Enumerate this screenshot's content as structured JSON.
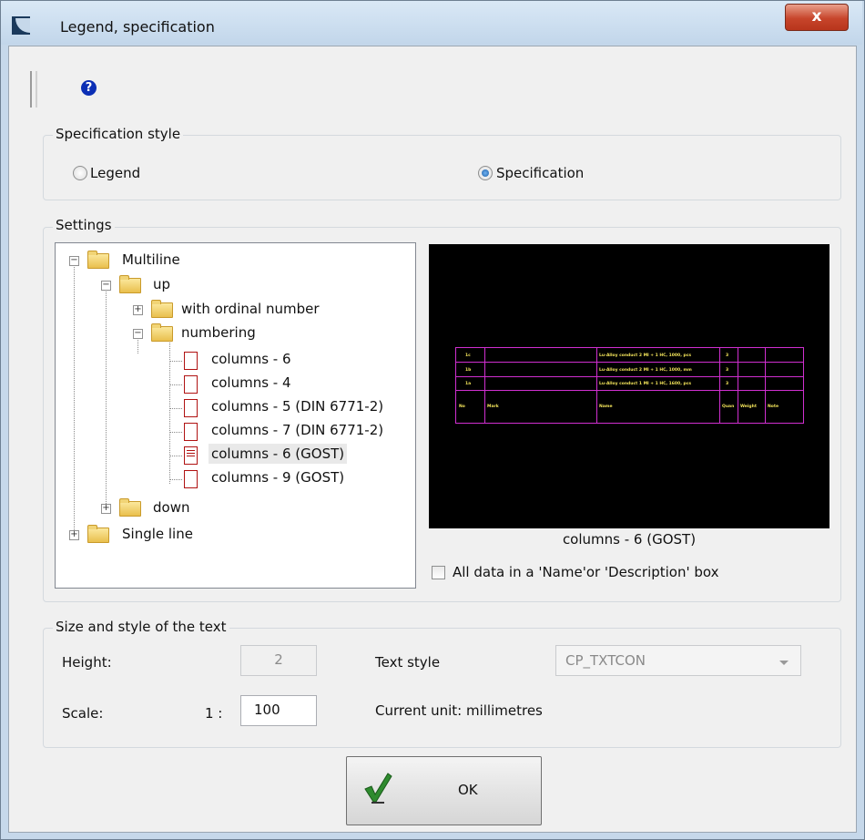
{
  "window": {
    "title": "Legend, specification",
    "close_glyph": "x"
  },
  "toolbar": {
    "help_glyph": "?"
  },
  "spec_style": {
    "group_title": "Specification style",
    "options": [
      {
        "label": "Legend",
        "selected": false
      },
      {
        "label": "Specification",
        "selected": true
      }
    ]
  },
  "settings": {
    "group_title": "Settings",
    "tree": [
      {
        "label": "Multiline",
        "type": "folder",
        "expanded": true
      },
      {
        "label": "up",
        "type": "folder",
        "expanded": true
      },
      {
        "label": "with ordinal number",
        "type": "folder",
        "expanded": false
      },
      {
        "label": "numbering",
        "type": "folder",
        "expanded": true
      },
      {
        "label": "columns - 6",
        "type": "doc"
      },
      {
        "label": "columns - 4",
        "type": "doc"
      },
      {
        "label": "columns - 5 (DIN 6771-2)",
        "type": "doc"
      },
      {
        "label": "columns - 7 (DIN 6771-2)",
        "type": "doc"
      },
      {
        "label": "columns - 6 (GOST)",
        "type": "doc",
        "selected": true
      },
      {
        "label": "columns - 9 (GOST)",
        "type": "doc"
      },
      {
        "label": "down",
        "type": "folder",
        "expanded": false
      },
      {
        "label": "Single line",
        "type": "folder",
        "expanded": false
      }
    ],
    "preview": {
      "rows": [
        {
          "c1": "1c",
          "name": "Lu-Alloy conduct 2 MI + 1 HC, 1000, pcs",
          "qty": "3"
        },
        {
          "c1": "1b",
          "name": "Lu-Alloy conduct 2 MI + 1 HC, 1000, mm",
          "qty": "3"
        },
        {
          "c1": "1a",
          "name": "Lu-Alloy conduct 1 MI + 1 HC, 1600, pcs",
          "qty": "3"
        }
      ],
      "header": {
        "c1": "No",
        "mark": "Mark",
        "name": "Name",
        "qty": "Quan",
        "weight": "Weight",
        "note": "Note"
      }
    },
    "preview_caption": "columns - 6 (GOST)",
    "all_data_checkbox": {
      "label": "All data in a 'Name'or 'Description' box",
      "checked": false
    }
  },
  "text": {
    "group_title": "Size and style of the text",
    "height_label": "Height:",
    "height_value": "2",
    "scale_label": "Scale:",
    "scale_prefix": "1 :",
    "scale_value": "100",
    "text_style_label": "Text style",
    "text_style_value": "CP_TXTCON",
    "current_unit": "Current unit: millimetres"
  },
  "buttons": {
    "ok_label": "OK"
  },
  "colors": {
    "preview_bg": "#000000",
    "preview_lines": "#d02fd0",
    "preview_text": "#f2e35a",
    "ok_check": "#2e8b2e"
  }
}
